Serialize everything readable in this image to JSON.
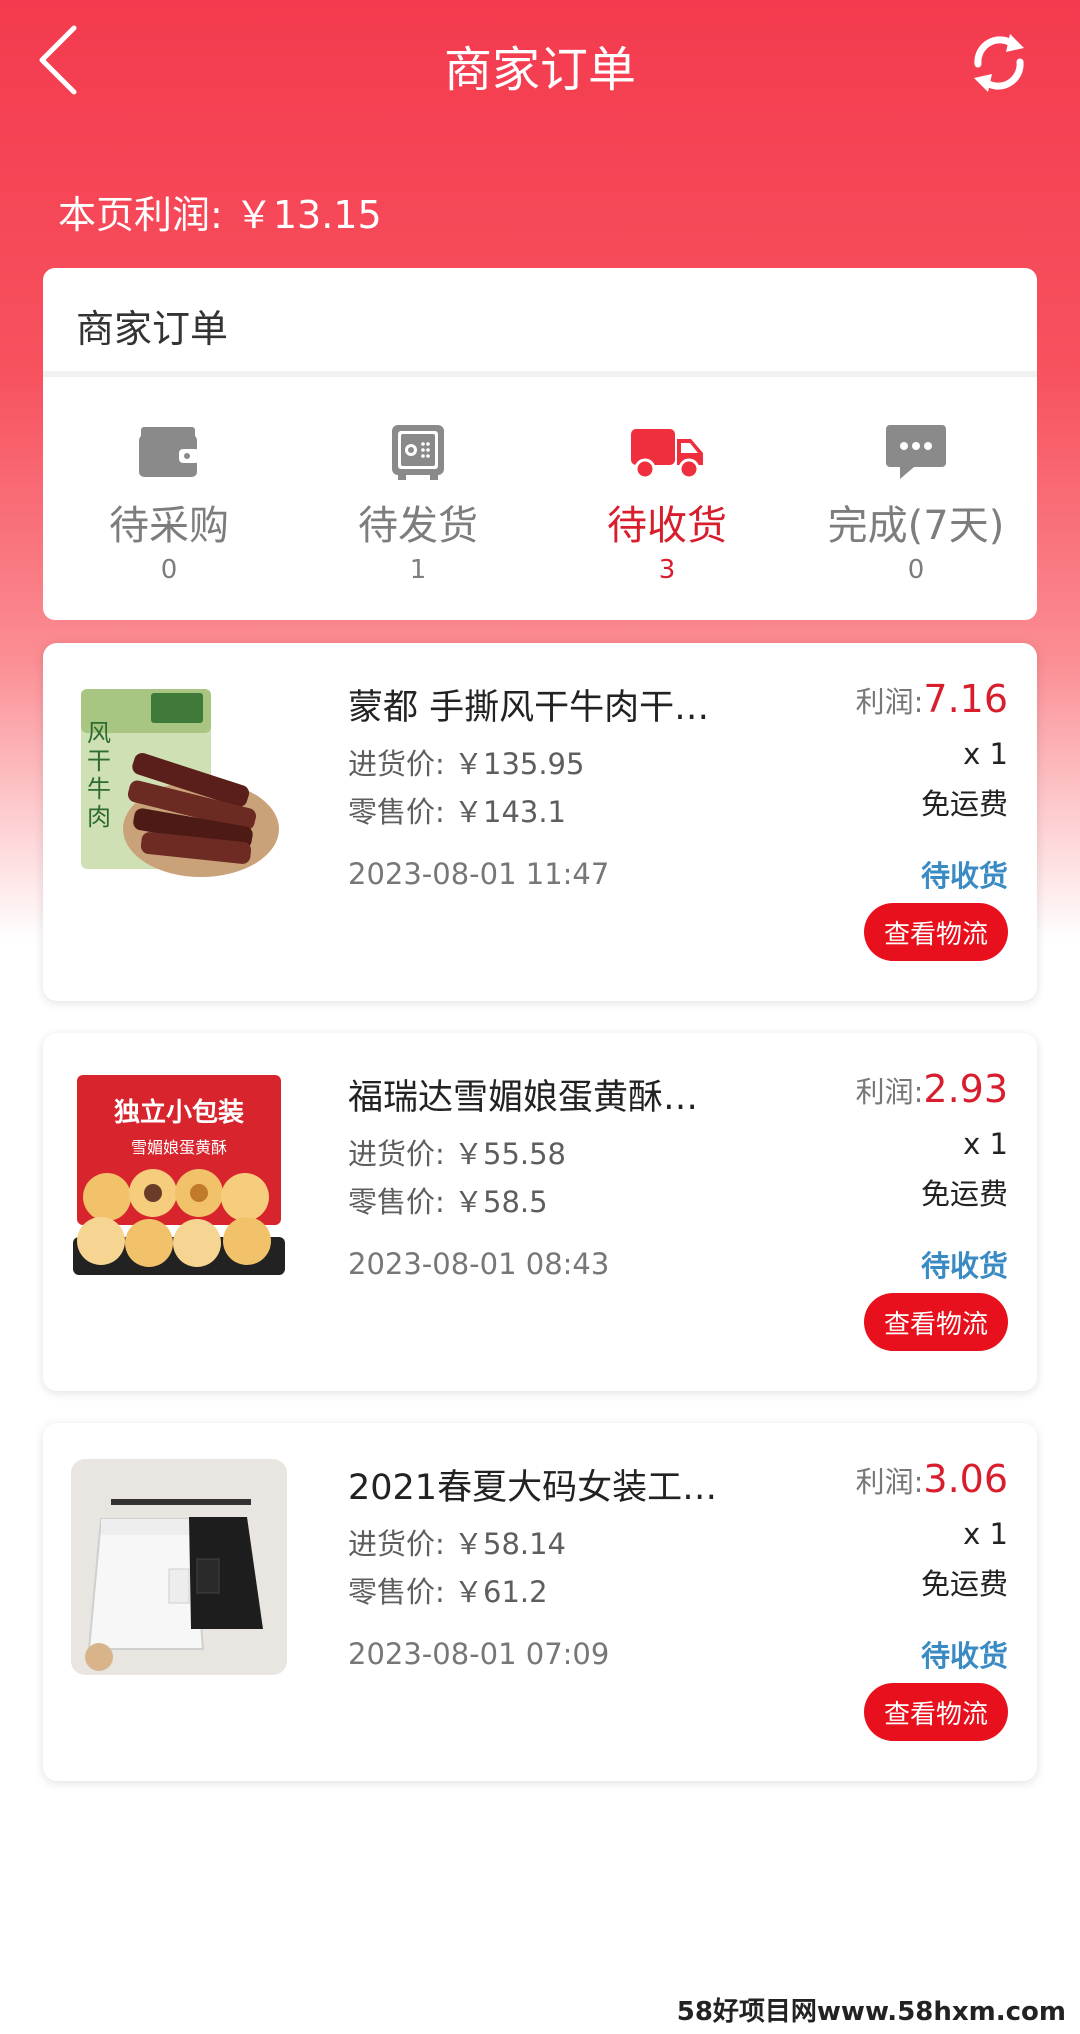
{
  "header": {
    "title": "商家订单"
  },
  "summary": {
    "profit_label": "本页利润: ￥13.15"
  },
  "tabs_card": {
    "title": "商家订单",
    "tabs": [
      {
        "label": "待采购",
        "count": "0",
        "icon": "wallet-icon",
        "active": false
      },
      {
        "label": "待发货",
        "count": "1",
        "icon": "safe-icon",
        "active": false
      },
      {
        "label": "待收货",
        "count": "3",
        "icon": "truck-icon",
        "active": true
      },
      {
        "label": "完成(7天)",
        "count": "0",
        "icon": "chat-bubble-icon",
        "active": false
      }
    ]
  },
  "orders": [
    {
      "name": "蒙都 手撕风干牛肉干…",
      "cost": "进货价: ￥135.95",
      "retail": "零售价: ￥143.1",
      "date": "2023-08-01 11:47",
      "profit_label": "利润:",
      "profit_value": "7.16",
      "qty": "x 1",
      "shipping": "免运费",
      "status": "待收货",
      "button": "查看物流",
      "thumb_text": [
        "风",
        "干",
        "牛",
        "肉"
      ]
    },
    {
      "name": "福瑞达雪媚娘蛋黄酥…",
      "cost": "进货价: ￥55.58",
      "retail": "零售价: ￥58.5",
      "date": "2023-08-01 08:43",
      "profit_label": "利润:",
      "profit_value": "2.93",
      "qty": "x 1",
      "shipping": "免运费",
      "status": "待收货",
      "button": "查看物流",
      "thumb_text": [
        "独立小包装",
        "雪媚娘蛋黄酥"
      ]
    },
    {
      "name": "2021春夏大码女装工…",
      "cost": "进货价: ￥58.14",
      "retail": "零售价: ￥61.2",
      "date": "2023-08-01 07:09",
      "profit_label": "利润:",
      "profit_value": "3.06",
      "qty": "x 1",
      "shipping": "免运费",
      "status": "待收货",
      "button": "查看物流"
    }
  ],
  "watermark": "58好项目网www.58hxm.com",
  "colors": {
    "brand_red": "#f43a4e",
    "accent_red": "#d81e2d",
    "button_red": "#e8101c",
    "status_blue": "#3a8bc4",
    "icon_gray": "#8a8a8a"
  }
}
